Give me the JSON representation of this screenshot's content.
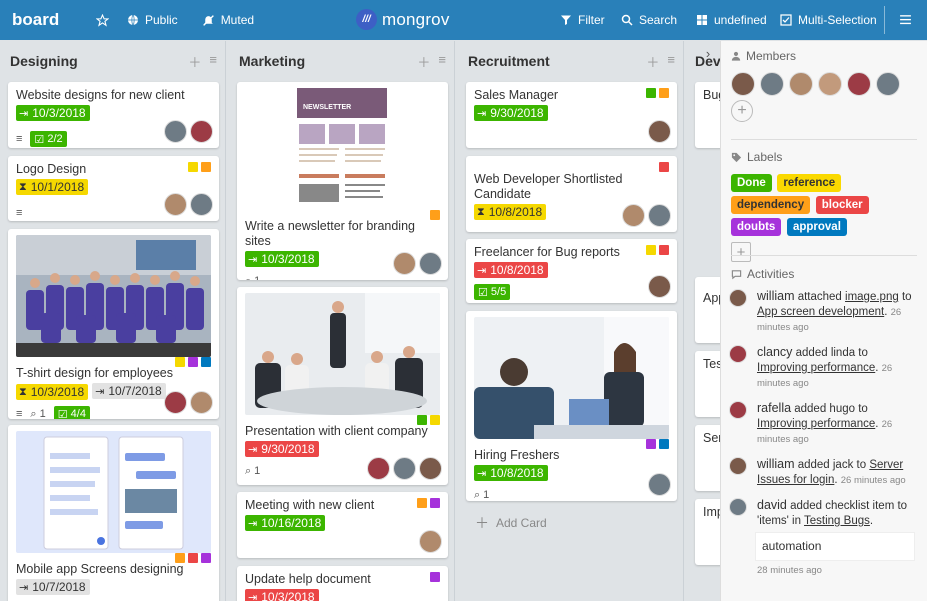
{
  "header": {
    "board_title": "board",
    "public_label": "Public",
    "muted_label": "Muted",
    "logo_text": "mongrov",
    "filter_label": "Filter",
    "search_label": "Search",
    "view_label": "undefined",
    "multi_selection_label": "Multi-Selection"
  },
  "lists": [
    {
      "title": "Designing",
      "cards": [
        {
          "title": "Website designs for new client",
          "date": "10/3/2018",
          "checklist": "2/2"
        },
        {
          "title": "Logo Design",
          "date": "10/1/2018"
        },
        {
          "title": "T-shirt design for employees",
          "date": "10/3/2018",
          "due": "10/7/2018",
          "attachments": "1",
          "checklist": "4/4"
        },
        {
          "title": "Mobile app Screens designing",
          "date": "10/7/2018"
        }
      ]
    },
    {
      "title": "Marketing",
      "cards": [
        {
          "title": "Write a newsletter for branding sites",
          "date": "10/3/2018",
          "attachments": "1",
          "cover_title": "NEWSLETTER"
        },
        {
          "title": "Presentation with client company",
          "date": "9/30/2018",
          "attachments": "1"
        },
        {
          "title": "Meeting with new client",
          "date": "10/16/2018"
        },
        {
          "title": "Update help document",
          "date": "10/3/2018"
        }
      ]
    },
    {
      "title": "Recruitment",
      "cards": [
        {
          "title": "Sales Manager",
          "date": "9/30/2018"
        },
        {
          "title": "Web Developer Shortlisted Candidate",
          "date": "10/8/2018"
        },
        {
          "title": "Freelancer for Bug reports",
          "date": "10/8/2018",
          "checklist": "5/5"
        },
        {
          "title": "Hiring Freshers",
          "date": "10/8/2018",
          "attachments": "1"
        }
      ],
      "add_card_label": "Add Card"
    },
    {
      "title": "Dev",
      "cards": [
        {
          "title": "Bug"
        },
        {
          "title": "App"
        },
        {
          "title": "Tes"
        },
        {
          "title": "Ser"
        },
        {
          "title": "Imp"
        }
      ]
    }
  ],
  "sidebar": {
    "members_title": "Members",
    "labels_title": "Labels",
    "labels": [
      {
        "name": "Done",
        "color": "#3cb500"
      },
      {
        "name": "reference",
        "color": "#fad900"
      },
      {
        "name": "dependency",
        "color": "#ff9f19"
      },
      {
        "name": "blocker",
        "color": "#eb4646"
      },
      {
        "name": "doubts",
        "color": "#a632db"
      },
      {
        "name": "approval",
        "color": "#0079bf"
      }
    ],
    "activities_title": "Activities",
    "activities": [
      {
        "user": "william",
        "action": "attached",
        "object": "image.png",
        "join": "to",
        "target": "App screen development",
        "time": "26 minutes ago"
      },
      {
        "user": "clancy",
        "action": "added linda to",
        "target": "Improving performance",
        "time": "26 minutes ago"
      },
      {
        "user": "rafella",
        "action": "added hugo to",
        "target": "Improving performance",
        "time": "26 minutes ago"
      },
      {
        "user": "william",
        "action": "added jack to",
        "target": "Server Issues for login",
        "time": "26 minutes ago"
      },
      {
        "user": "david",
        "action": "added checklist item to 'items' in",
        "target": "Testing Bugs",
        "comment": "automation",
        "time": "28 minutes ago"
      }
    ]
  },
  "colors": {
    "header": "#2980b9",
    "green": "#3cb500",
    "yellow": "#f5d800",
    "red": "#eb4646",
    "orange": "#ff9f19",
    "purple": "#a632db",
    "blue": "#0079bf"
  }
}
